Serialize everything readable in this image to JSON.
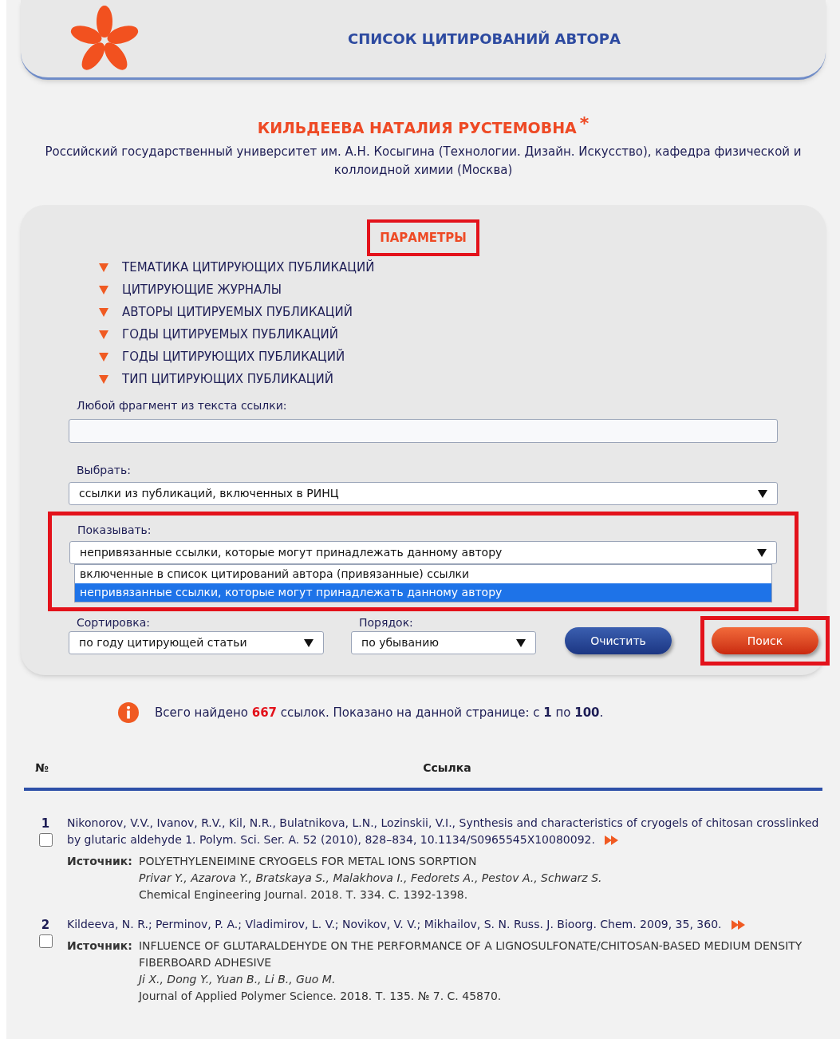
{
  "header": {
    "title": "СПИСОК ЦИТИРОВАНИЙ АВТОРА"
  },
  "author": {
    "name": "КИЛЬДЕЕВА НАТАЛИЯ РУСТЕМОВНА",
    "marker": "*",
    "affiliation": "Российский государственный университет им. А.Н. Косыгина (Технологии. Дизайн. Искусство), кафедра физической и коллоидной химии (Москва)"
  },
  "parameters": {
    "title": "ПАРАМЕТРЫ",
    "highlighted": true,
    "sections": [
      "ТЕМАТИКА ЦИТИРУЮЩИХ ПУБЛИКАЦИЙ",
      "ЦИТИРУЮЩИЕ ЖУРНАЛЫ",
      "АВТОРЫ ЦИТИРУЕМЫХ ПУБЛИКАЦИЙ",
      "ГОДЫ ЦИТИРУЕМЫХ ПУБЛИКАЦИЙ",
      "ГОДЫ ЦИТИРУЮЩИХ ПУБЛИКАЦИЙ",
      "ТИП ЦИТИРУЮЩИХ ПУБЛИКАЦИЙ"
    ],
    "fragment_field": {
      "label": "Любой фрагмент из текста ссылки:"
    },
    "select_field": {
      "label": "Выбрать:",
      "value": "ссылки из публикаций, включенных в РИНЦ"
    },
    "show_field": {
      "label": "Показывать:",
      "value": "непривязанные ссылки, которые могут принадлежать данному автору",
      "expanded": true,
      "highlighted": true,
      "options": [
        {
          "label": "включенные в список цитирований автора (привязанные) ссылки",
          "selected": false
        },
        {
          "label": "непривязанные ссылки, которые могут принадлежать данному автору",
          "selected": true
        }
      ]
    },
    "sort_field": {
      "label": "Сортировка:",
      "value": "по году цитирующей статьи"
    },
    "order_field": {
      "label": "Порядок:",
      "value": "по убыванию"
    },
    "buttons": [
      {
        "label": "Очистить",
        "kind": "secondary",
        "highlighted": false
      },
      {
        "label": "Поиск",
        "kind": "primary",
        "highlighted": true
      }
    ]
  },
  "summary": "Всего найдено **667** ссылок. Показано на данной странице: с **1** по **100**.",
  "table": {
    "columns": [
      "№",
      "Ссылка"
    ],
    "rows": [
      {
        "number": "1",
        "checked": false,
        "citation": "Nikonorov, V.V., Ivanov, R.V., Kil, N.R., Bulatnikova, L.N., Lozinskii, V.I., Synthesis and characteristics of cryogels of chitosan crosslinked by glutaric aldehyde 1. Polym. Sci. Ser. A. 52 (2010), 828–834, 10.1134/S0965545X10080092.",
        "source_label": "Источник:",
        "source_title": "POLYETHYLENEIMINE CRYOGELS FOR METAL IONS SORPTION",
        "source_authors": "Privar Y., Azarova Y., Bratskaya S., Malakhova I., Fedorets A., Pestov A., Schwarz S.",
        "source_journal": "Chemical Engineering Journal. 2018. Т. 334. С. 1392-1398."
      },
      {
        "number": "2",
        "checked": false,
        "citation": "Kildeeva, N. R.; Perminov, P. A.; Vladimirov, L. V.; Novikov, V. V.; Mikhailov, S. N. Russ. J. Bioorg. Chem. 2009, 35, 360.",
        "source_label": "Источник:",
        "source_title": "INFLUENCE OF GLUTARALDEHYDE ON THE PERFORMANCE OF A LIGNOSULFONATE/CHITOSAN-BASED MEDIUM DENSITY FIBERBOARD ADHESIVE",
        "source_authors": "Ji X., Dong Y., Yuan B., Li B., Guo M.",
        "source_journal": "Journal of Applied Polymer Science. 2018. Т. 135. № 7. С. 45870."
      }
    ]
  }
}
